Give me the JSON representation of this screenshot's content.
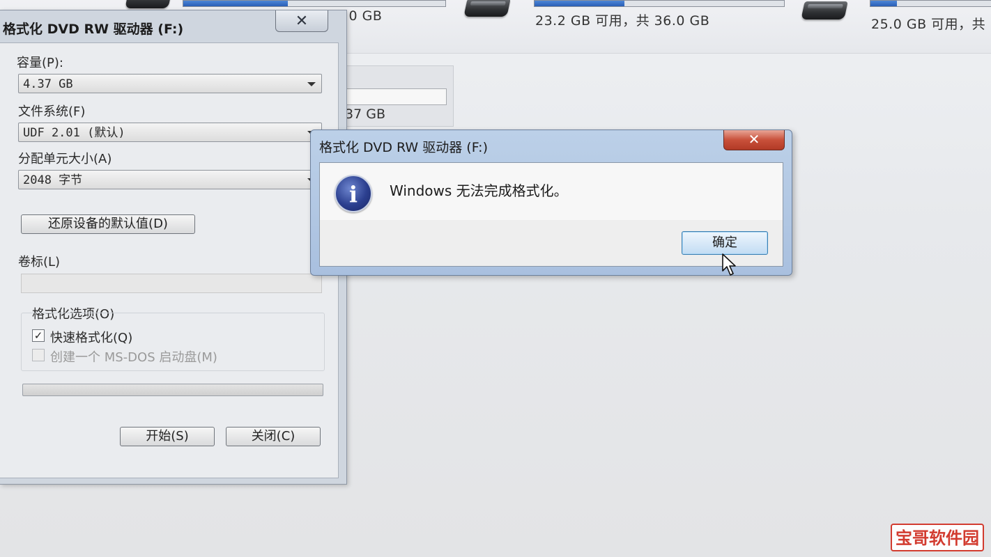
{
  "background": {
    "drives": [
      {
        "text": ".0 GB"
      },
      {
        "text": "23.2 GB 可用，共 36.0 GB"
      },
      {
        "text": "25.0 GB 可用，共 "
      }
    ],
    "panel_text": "37 GB"
  },
  "format_dialog": {
    "title": "格式化 DVD RW 驱动器 (F:)",
    "close_glyph": "✕",
    "capacity_label": "容量(P):",
    "capacity_value": "4.37 GB",
    "filesystem_label": "文件系统(F)",
    "filesystem_value": "UDF 2.01 (默认)",
    "allocation_label": "分配单元大小(A)",
    "allocation_value": "2048 字节",
    "restore_button": "还原设备的默认值(D)",
    "volume_label": "卷标(L)",
    "volume_value": "",
    "options_label": "格式化选项(O)",
    "quick_format_label": "快速格式化(Q)",
    "quick_format_checked": true,
    "msdos_label": "创建一个 MS-DOS 启动盘(M)",
    "msdos_checked": false,
    "progress": 0,
    "start_button": "开始(S)",
    "close_button": "关闭(C)"
  },
  "message_box": {
    "title": "格式化 DVD RW 驱动器 (F:)",
    "close_glyph": "✕",
    "icon": "info-icon",
    "message": "Windows 无法完成格式化。",
    "ok_button": "确定"
  },
  "watermark": "宝哥软件园"
}
